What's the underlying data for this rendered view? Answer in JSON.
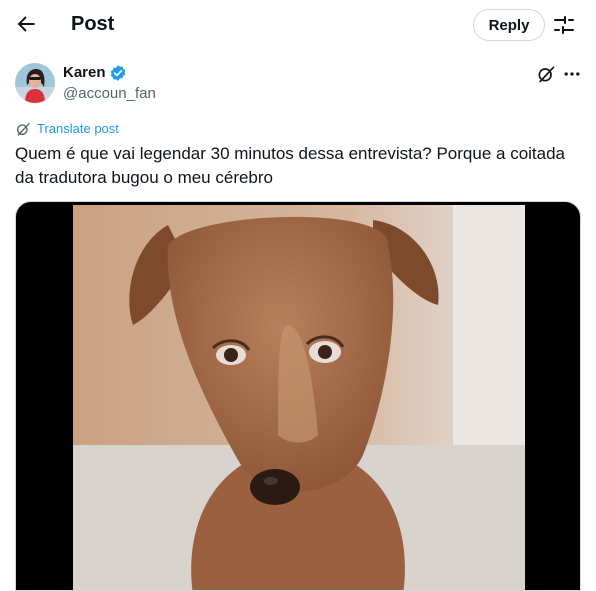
{
  "header": {
    "title": "Post",
    "reply_label": "Reply"
  },
  "author": {
    "name": "Karen",
    "handle": "@accoun_fan",
    "verified": true
  },
  "post": {
    "translate_label": "Translate post",
    "text": "Quem é que vai legendar 30 minutos dessa entrevista? Porque a coitada da tradutora bugou o meu cérebro"
  },
  "icons": {
    "back": "arrow-left-icon",
    "settings": "sliders-icon",
    "verified": "verified-badge-icon",
    "grok": "grok-icon",
    "more": "more-horizontal-icon",
    "translate": "translate-icon"
  },
  "colors": {
    "accent": "#1d9bf0",
    "text": "#0f1419",
    "secondary": "#536471",
    "border": "#cfd9de"
  }
}
